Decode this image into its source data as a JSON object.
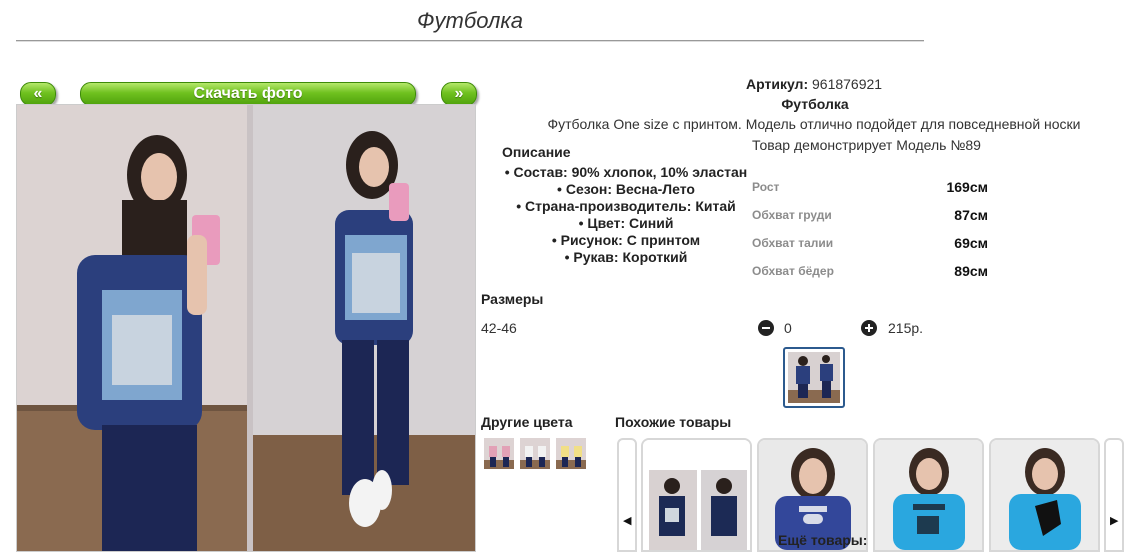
{
  "page": {
    "title": "Футболка"
  },
  "gallery": {
    "prev_label": "«",
    "download_label": "Скачать фото",
    "next_label": "»"
  },
  "product": {
    "article_label": "Артикул:",
    "article_value": "961876921",
    "name": "Футболка",
    "description": "Футболка One size с принтом. Модель отлично подойдет для повседневной носки",
    "model_line": "Товар демонстрирует Модель №89"
  },
  "properties": {
    "title": "Описание",
    "items": [
      "Состав: 90% хлопок, 10% эластан",
      "Сезон: Весна-Лето",
      "Страна-производитель: Китай",
      "Цвет: Синий",
      "Рисунок: С принтом",
      "Рукав: Короткий"
    ]
  },
  "measurements": [
    {
      "label": "Рост",
      "value": "169см"
    },
    {
      "label": "Обхват груди",
      "value": "87см"
    },
    {
      "label": "Обхват талии",
      "value": "69см"
    },
    {
      "label": "Обхват бёдер",
      "value": "89см"
    }
  ],
  "sizes": {
    "title": "Размеры",
    "range": "42-46",
    "quantity": "0",
    "price": "215р."
  },
  "other_colors": {
    "title": "Другие цвета",
    "count": 3
  },
  "similar": {
    "title": "Похожие товары",
    "more_label": "Ещё товары:",
    "prev_icon": "◀",
    "next_icon": "▶"
  },
  "colors": {
    "accent_green": "#6fc11f",
    "shirt_blue": "#2a3f7c",
    "thumb_border": "#2c5a8e"
  }
}
